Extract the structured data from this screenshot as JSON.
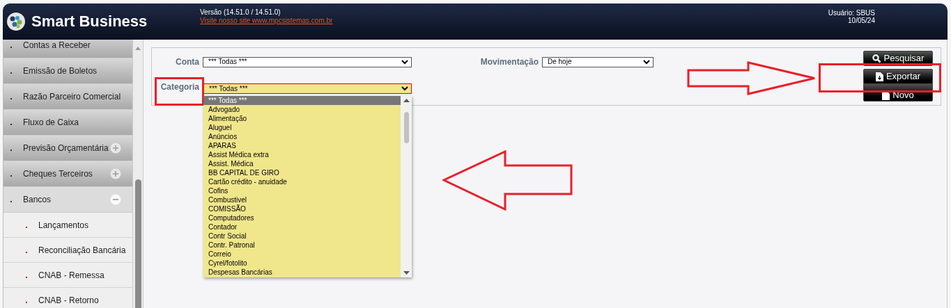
{
  "header": {
    "title": "Smart Business",
    "version": "Versão (14.51.0 / 14.51.0)",
    "site_link": "Visite nosso site www.mpcsistemas.com.br",
    "user": "Usuário: SBUS",
    "date": "10/05/24"
  },
  "sidebar": {
    "items": [
      {
        "label": "Contas a Receber"
      },
      {
        "label": "Emissão de Boletos"
      },
      {
        "label": "Razão Parceiro Comercial"
      },
      {
        "label": "Fluxo de Caixa"
      },
      {
        "label": "Previsão Orçamentária",
        "expanded": false
      },
      {
        "label": "Cheques Terceiros",
        "expanded": false
      },
      {
        "label": "Bancos",
        "expanded": true,
        "children": [
          {
            "label": "Lançamentos"
          },
          {
            "label": "Reconciliação Bancária"
          },
          {
            "label": "CNAB - Remessa"
          },
          {
            "label": "CNAB - Retorno"
          }
        ]
      }
    ]
  },
  "filters": [
    {
      "label": "Conta",
      "value": "*** Todas ***",
      "open": false
    },
    {
      "label": "Movimentação",
      "value": "De hoje",
      "open": false
    },
    {
      "label": "Categoria",
      "value": "*** Todas ***",
      "open": true
    }
  ],
  "dropdown": {
    "options": [
      {
        "label": "*** Todas ***",
        "selected": true
      },
      {
        "label": "Advogado",
        "selected": false
      },
      {
        "label": "Alimentação",
        "selected": false
      },
      {
        "label": "Aluguel",
        "selected": false
      },
      {
        "label": "Anúncios",
        "selected": false
      },
      {
        "label": "APARAS",
        "selected": false
      },
      {
        "label": "Assist Médica extra",
        "selected": false
      },
      {
        "label": "Assist. Médica",
        "selected": false
      },
      {
        "label": "BB CAPITAL DE GIRO",
        "selected": false
      },
      {
        "label": "Cartão crédito - anuidade",
        "selected": false
      },
      {
        "label": "Cofins",
        "selected": false
      },
      {
        "label": "Combustivel",
        "selected": false
      },
      {
        "label": "COMISSÃO",
        "selected": false
      },
      {
        "label": "Computadores",
        "selected": false
      },
      {
        "label": "Contador",
        "selected": false
      },
      {
        "label": "Contr Social",
        "selected": false
      },
      {
        "label": "Contr. Patronal",
        "selected": false
      },
      {
        "label": "Correio",
        "selected": false
      },
      {
        "label": "Cyrel/fotolito",
        "selected": false
      },
      {
        "label": "Despesas Bancárias",
        "selected": false
      }
    ]
  },
  "buttons": [
    {
      "label": "Pesquisar",
      "kind": "search"
    },
    {
      "label": "Exportar",
      "kind": "export"
    },
    {
      "label": "Novo",
      "kind": "new"
    }
  ]
}
